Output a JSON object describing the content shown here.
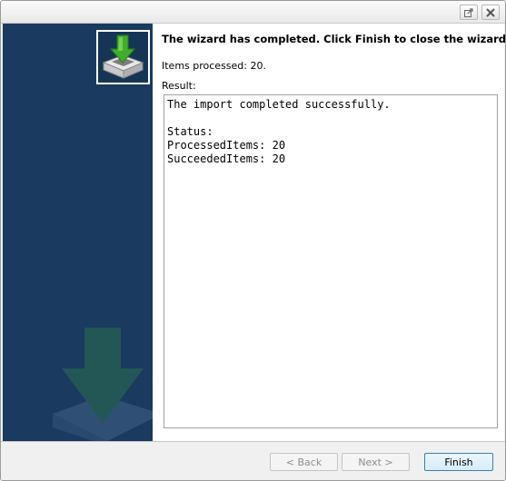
{
  "window": {
    "restore_icon": "external-window-icon",
    "close_icon": "close-icon"
  },
  "side": {
    "logo_icon": "import-tray-download-icon",
    "watermark_icon": "import-tray-download-watermark"
  },
  "content": {
    "heading": "The wizard has completed. Click Finish to close the wizard.",
    "items_processed": "Items processed: 20.",
    "result_label": "Result:",
    "result_text": "The import completed successfully.\n\nStatus:\nProcessedItems: 20\nSucceededItems: 20"
  },
  "buttons": {
    "back_label": "< Back",
    "next_label": "Next >",
    "finish_label": "Finish"
  },
  "colors": {
    "side_panel": "#1a3a60",
    "arrow_green": "#3fae2a",
    "finish_border": "#3c7fb1"
  }
}
